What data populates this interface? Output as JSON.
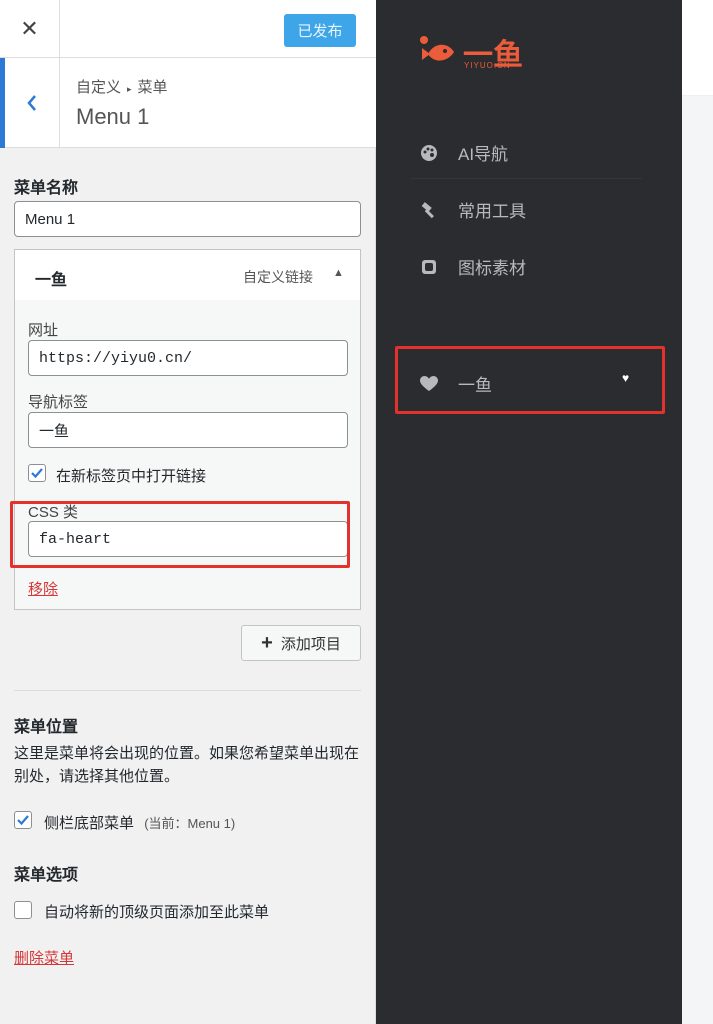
{
  "topbar": {
    "close_glyph": "✕",
    "publish_label": "已发布"
  },
  "section": {
    "crumb_parent": "自定义",
    "crumb_current": "菜单",
    "title": "Menu 1"
  },
  "menu_name": {
    "label": "菜单名称",
    "value": "Menu 1"
  },
  "menu_item": {
    "title": "一鱼",
    "type": "自定义链接",
    "url_label": "网址",
    "url_value": "https://yiyu0.cn/",
    "nav_label_label": "导航标签",
    "nav_label_value": "一鱼",
    "open_new_tab": {
      "label": "在新标签页中打开链接",
      "checked": true
    },
    "css_label": "CSS 类",
    "css_value": "fa-heart",
    "remove_label": "移除"
  },
  "add_item_label": "添加项目",
  "menu_location": {
    "heading": "菜单位置",
    "description": "这里是菜单将会出现的位置。如果您希望菜单出现在别处，请选择其他位置。",
    "option_label": "侧栏底部菜单",
    "option_note": "(当前：Menu 1)",
    "option_checked": true
  },
  "menu_options": {
    "heading": "菜单选项",
    "auto_add_label": "自动将新的顶级页面添加至此菜单",
    "auto_add_checked": false
  },
  "delete_menu_label": "删除菜单",
  "preview": {
    "logo_text": "一鱼",
    "logo_sub": "YIYUO.CN",
    "nav": [
      {
        "label": "AI导航",
        "icon": "palette-icon"
      },
      {
        "label": "常用工具",
        "icon": "hammer-icon"
      },
      {
        "label": "图标素材",
        "icon": "image-icon"
      }
    ],
    "heart_item": {
      "label": "一鱼",
      "icon": "heart-icon"
    },
    "mini_heart": "♥"
  },
  "colors": {
    "accent": "#2c7ad6",
    "publish": "#3ea5e9",
    "highlight": "#e3312d",
    "sidebar_dark": "#2b2c2f",
    "logo": "#ec5b3a"
  }
}
